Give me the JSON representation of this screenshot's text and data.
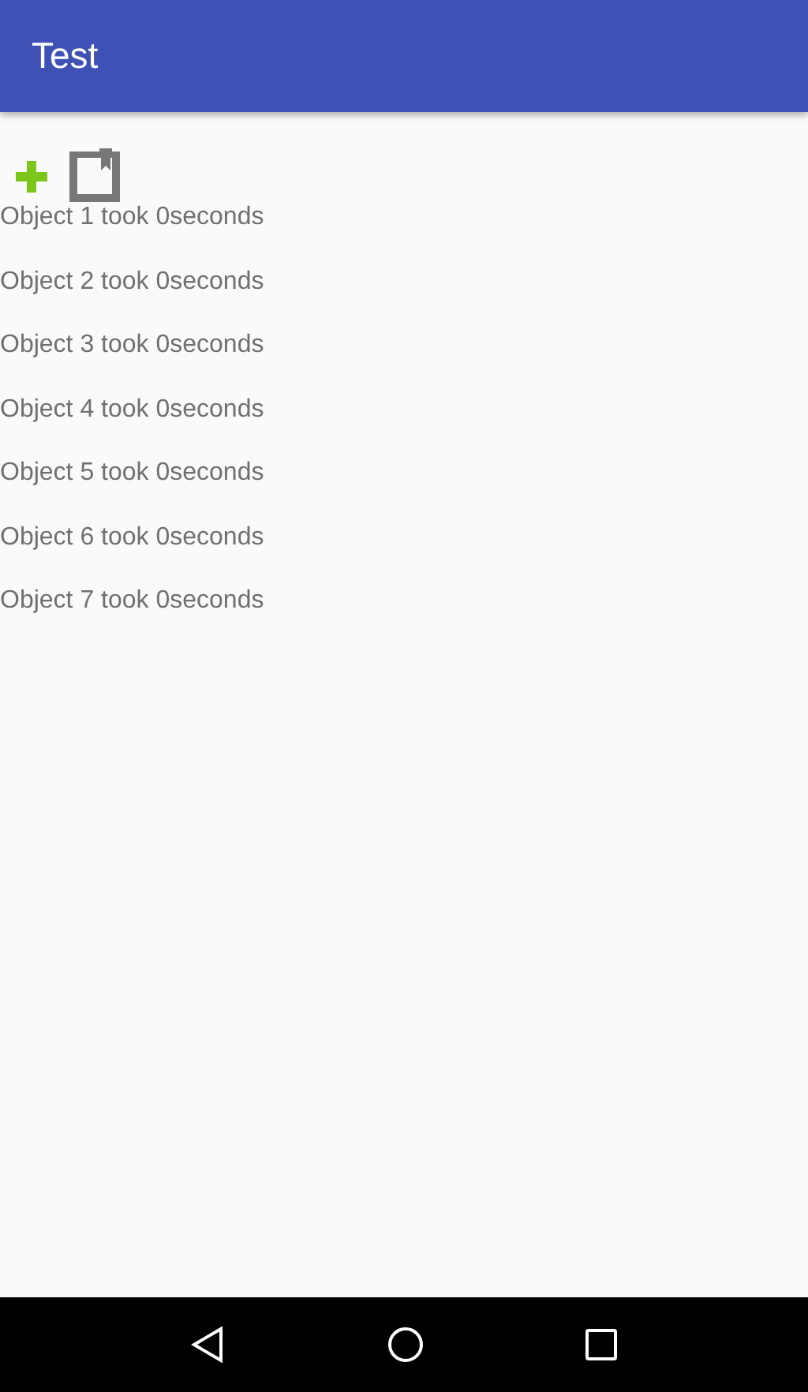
{
  "app_bar": {
    "title": "Test"
  },
  "items": [
    "Object 1 took 0seconds",
    "Object 2 took 0seconds",
    "Object 3 took 0seconds",
    "Object 4 took 0seconds",
    "Object 5 took 0seconds",
    "Object 6 took 0seconds",
    "Object 7 took 0seconds"
  ]
}
